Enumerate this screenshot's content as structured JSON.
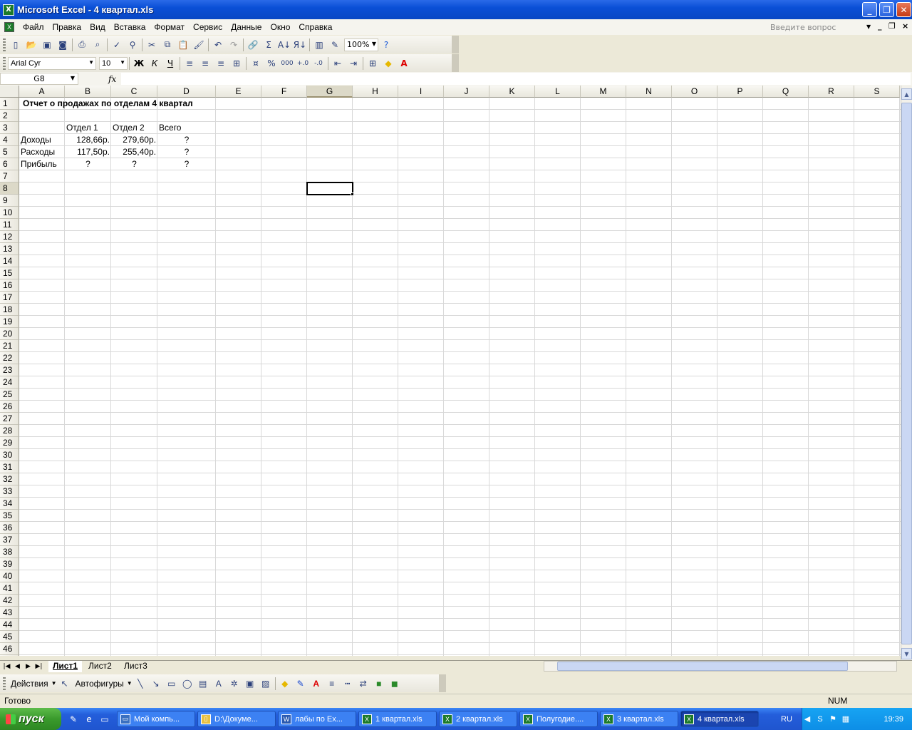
{
  "window": {
    "title": "Microsoft Excel - 4 квартал.xls"
  },
  "menu": {
    "items": [
      "Файл",
      "Правка",
      "Вид",
      "Вставка",
      "Формат",
      "Сервис",
      "Данные",
      "Окно",
      "Справка"
    ],
    "ask_placeholder": "Введите вопрос"
  },
  "toolbar": {
    "zoom": "100%",
    "font": "Arial Cyr",
    "size": "10",
    "bold": "Ж",
    "italic": "К",
    "underline": "Ч",
    "percent": "%",
    "thousands": "000",
    "sum": "Σ"
  },
  "formula_bar": {
    "name_box": "G8",
    "fx": "fx",
    "content": ""
  },
  "sheet": {
    "columns": [
      "A",
      "B",
      "C",
      "D",
      "E",
      "F",
      "G",
      "H",
      "I",
      "J",
      "K",
      "L",
      "M",
      "N",
      "O",
      "P",
      "Q",
      "R",
      "S"
    ],
    "selected_column": "G",
    "selected_row": 8,
    "row_count_visible": 46,
    "cells": {
      "A1": "Отчет о продажах по отделам 4 квартал",
      "B3": "Отдел 1",
      "C3": "Отдел 2",
      "D3": "Всего",
      "A4": "Доходы",
      "B4": "128,66р.",
      "C4": "279,60р.",
      "D4": "?",
      "A5": "Расходы",
      "B5": "117,50р.",
      "C5": "255,40р.",
      "D5": "?",
      "A6": "Прибыль",
      "B6": "?",
      "C6": "?",
      "D6": "?"
    }
  },
  "tabs": [
    "Лист1",
    "Лист2",
    "Лист3"
  ],
  "active_tab": "Лист1",
  "drawing": {
    "actions": "Действия",
    "autoshapes": "Автофигуры"
  },
  "status": {
    "ready": "Готово",
    "num": "NUM"
  },
  "taskbar": {
    "start": "пуск",
    "tasks": [
      "Мой компь...",
      "D:\\Докуме...",
      "лабы по Ex...",
      "1 квартал.xls",
      "2 квартал.xls",
      "Полугодие....",
      "3 квартал.xls",
      "4 квартал.xls"
    ],
    "active_task": "4 квартал.xls",
    "lang": "RU",
    "clock": "19:39"
  }
}
